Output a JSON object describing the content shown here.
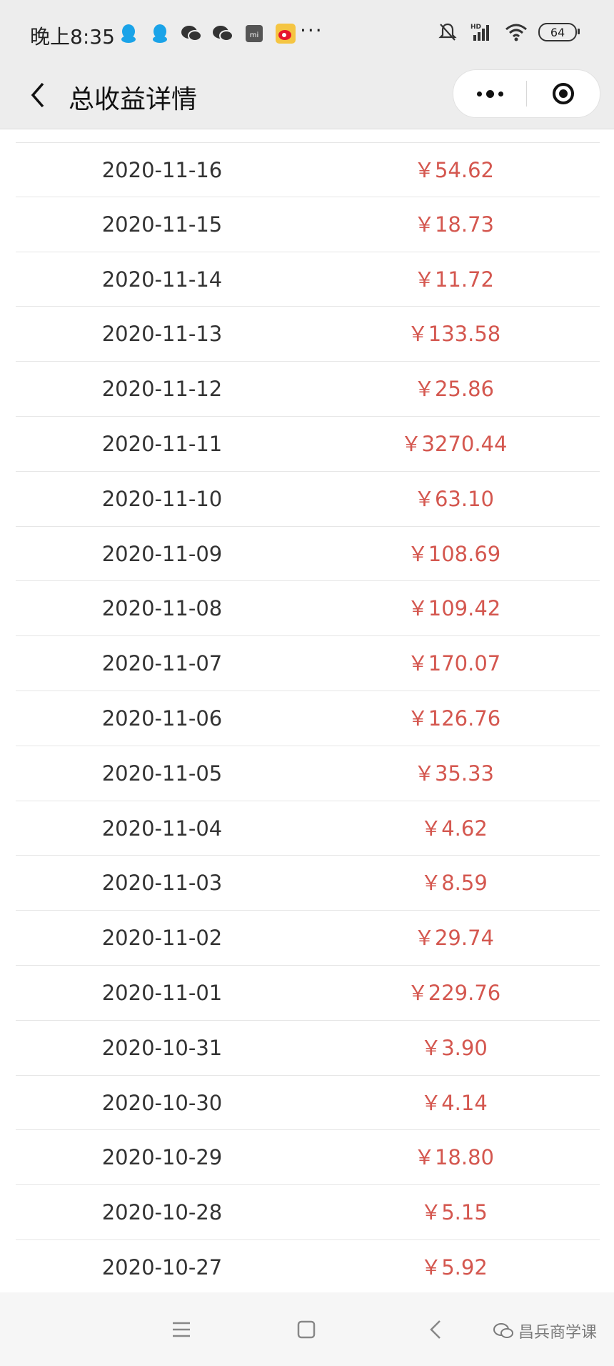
{
  "status_bar": {
    "time": "晚上8:35",
    "battery": "64",
    "network_label": "HD"
  },
  "nav": {
    "title": "总收益详情"
  },
  "accent_color": "#d4574f",
  "rows": [
    {
      "date": "2020-11-16",
      "amount": "￥54.62"
    },
    {
      "date": "2020-11-15",
      "amount": "￥18.73"
    },
    {
      "date": "2020-11-14",
      "amount": "￥11.72"
    },
    {
      "date": "2020-11-13",
      "amount": "￥133.58"
    },
    {
      "date": "2020-11-12",
      "amount": "￥25.86"
    },
    {
      "date": "2020-11-11",
      "amount": "￥3270.44"
    },
    {
      "date": "2020-11-10",
      "amount": "￥63.10"
    },
    {
      "date": "2020-11-09",
      "amount": "￥108.69"
    },
    {
      "date": "2020-11-08",
      "amount": "￥109.42"
    },
    {
      "date": "2020-11-07",
      "amount": "￥170.07"
    },
    {
      "date": "2020-11-06",
      "amount": "￥126.76"
    },
    {
      "date": "2020-11-05",
      "amount": "￥35.33"
    },
    {
      "date": "2020-11-04",
      "amount": "￥4.62"
    },
    {
      "date": "2020-11-03",
      "amount": "￥8.59"
    },
    {
      "date": "2020-11-02",
      "amount": "￥29.74"
    },
    {
      "date": "2020-11-01",
      "amount": "￥229.76"
    },
    {
      "date": "2020-10-31",
      "amount": "￥3.90"
    },
    {
      "date": "2020-10-30",
      "amount": "￥4.14"
    },
    {
      "date": "2020-10-29",
      "amount": "￥18.80"
    },
    {
      "date": "2020-10-28",
      "amount": "￥5.15"
    },
    {
      "date": "2020-10-27",
      "amount": "￥5.92"
    }
  ],
  "watermark": "昌兵商学课",
  "icons": {
    "status_left": [
      "qq-icon",
      "qq-icon",
      "wechat-icon",
      "wechat-icon",
      "mi-icon",
      "weibo-icon"
    ],
    "status_right": [
      "mute-bell-icon",
      "signal-icon",
      "wifi-icon",
      "battery-icon"
    ]
  }
}
